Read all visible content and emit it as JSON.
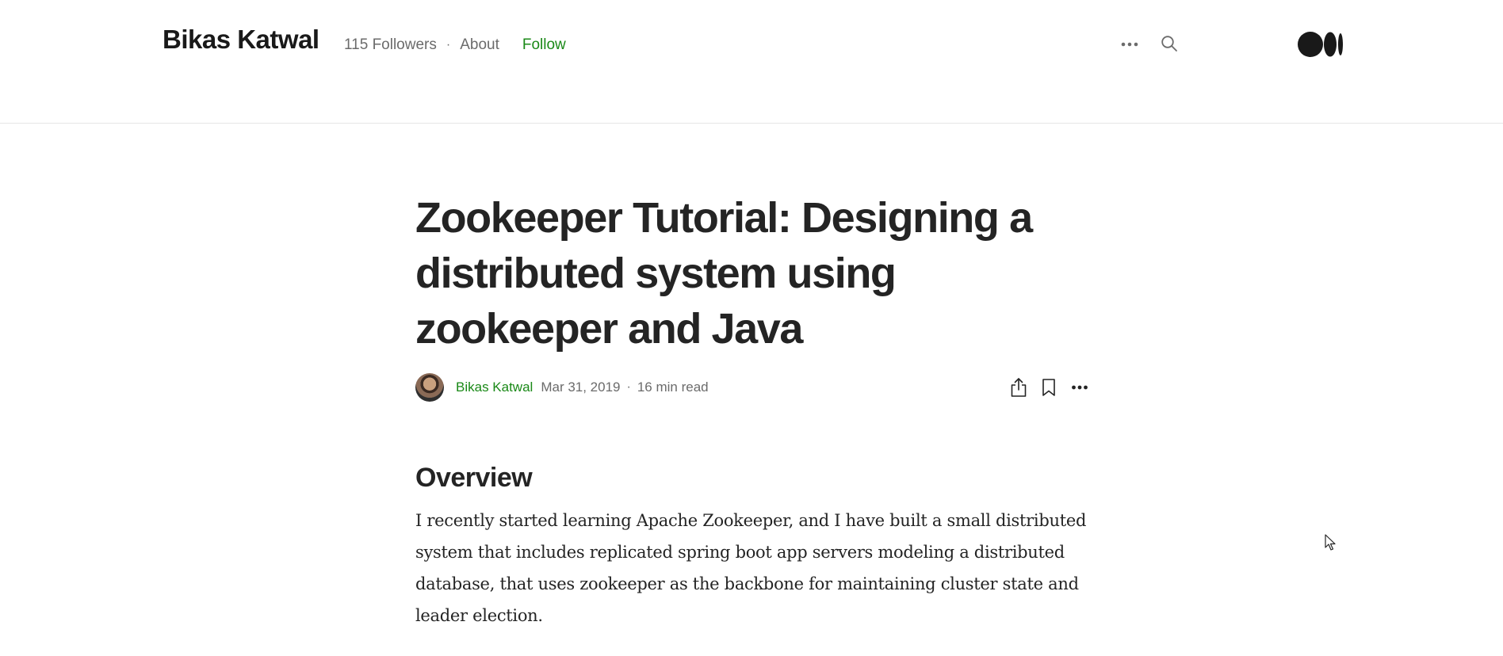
{
  "header": {
    "site_name": "Bikas Katwal",
    "followers": "115 Followers",
    "separator": "·",
    "about_label": "About",
    "follow_label": "Follow"
  },
  "icons": {
    "more_top": "more-horizontal-icon",
    "search": "search-icon",
    "logo": "medium-logo-icon",
    "share": "share-icon",
    "bookmark": "bookmark-icon",
    "more": "more-horizontal-icon"
  },
  "article": {
    "title": "Zookeeper Tutorial: Designing a distributed system using zookeeper and Java",
    "author": "Bikas Katwal",
    "date": "Mar 31, 2019",
    "separator": "·",
    "read_time": "16 min read",
    "section_heading": "Overview",
    "paragraph": "I recently started learning Apache Zookeeper, and I have built a small distributed system that includes replicated spring boot app servers modeling a distributed database, that uses zookeeper as the backbone for maintaining cluster state and leader election."
  },
  "colors": {
    "accent_green": "#1a8917",
    "text_primary": "#242424",
    "text_secondary": "#6b6b6b",
    "divider": "#e6e6e6"
  }
}
